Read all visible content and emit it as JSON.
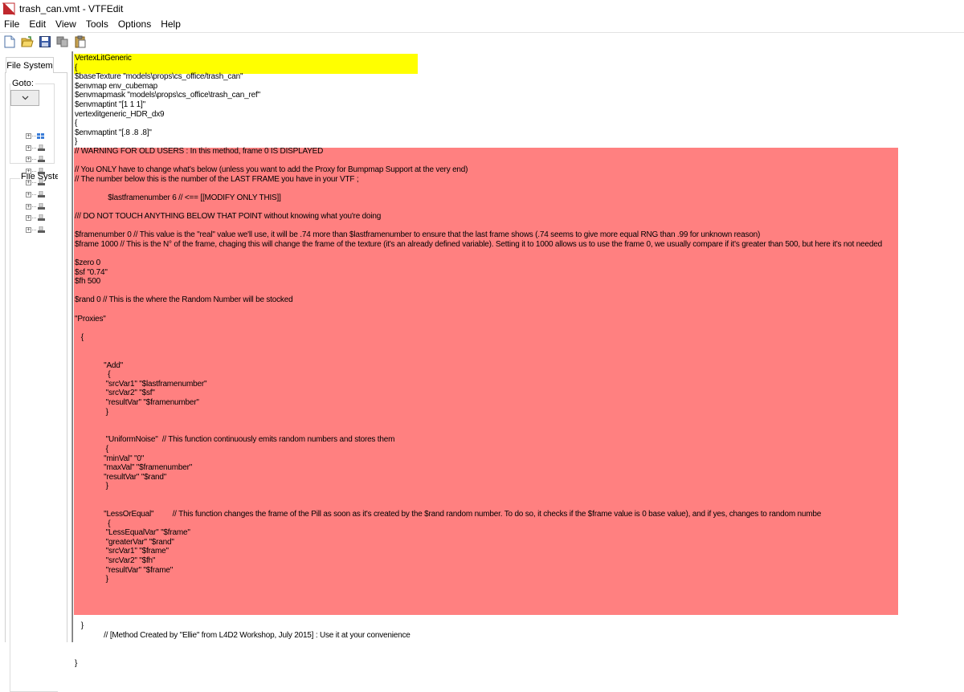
{
  "window": {
    "title": "trash_can.vmt - VTFEdit"
  },
  "menu": {
    "items": [
      "File",
      "Edit",
      "View",
      "Tools",
      "Options",
      "Help"
    ]
  },
  "toolbar": {
    "buttons": [
      "new-icon",
      "open-icon",
      "save-icon",
      "copy-icon",
      "paste-icon"
    ]
  },
  "left_panel": {
    "tab_label": "File System",
    "goto_label": "Goto:",
    "fs_label": "File System",
    "tree_item_count": 9
  },
  "editor": {
    "lines": [
      "VertexLitGeneric",
      "{",
      "$baseTexture \"models\\props\\cs_office/trash_can\"",
      "$envmap env_cubemap",
      "$envmapmask \"models\\props\\cs_office\\trash_can_ref\"",
      "$envmaptint \"[1 1 1]\"",
      "vertexlitgeneric_HDR_dx9",
      "{",
      "$envmaptint \"[.8 .8 .8]\"",
      "}",
      "// WARNING FOR OLD USERS : In this method, frame 0 IS DISPLAYED",
      "",
      "// You ONLY have to change what's below (unless you want to add the Proxy for Bumpmap Support at the very end)",
      "// The number below this is the number of the LAST FRAME you have in your VTF ;",
      "",
      "                $lastframenumber 6 // <== [[MODIFY ONLY THIS]]",
      "",
      "/// DO NOT TOUCH ANYTHING BELOW THAT POINT without knowing what you're doing",
      "",
      "$framenumber 0 // This value is the \"real\" value we'll use, it will be .74 more than $lastframenumber to ensure that the last frame shows (.74 seems to give more equal RNG than .99 for unknown reason)",
      "$frame 1000 // This is the N° of the frame, chaging this will change the frame of the texture (it's an already defined variable). Setting it to 1000 allows us to use the frame 0, we usually compare if it's greater than 500, but here it's not needed",
      "",
      "$zero 0",
      "$sf \"0.74\"",
      "$fh 500",
      "",
      "$rand 0 // This is the where the Random Number will be stocked",
      "",
      "\"Proxies\"",
      "",
      "   {",
      "",
      "",
      "              \"Add\"",
      "                {",
      "               \"srcVar1\" \"$lastframenumber\"",
      "               \"srcVar2\" \"$sf\"",
      "               \"resultVar\" \"$framenumber\"",
      "               }",
      "",
      "",
      "               \"UniformNoise\"  // This function continuously emits random numbers and stores them",
      "               {",
      "              \"minVal\" \"0\"",
      "              \"maxVal\" \"$framenumber\"",
      "              \"resultVar\" \"$rand\"",
      "               }",
      "",
      "",
      "              \"LessOrEqual\"         // This function changes the frame of the Pill as soon as it's created by the $rand random number. To do so, it checks if the $frame value is 0 base value), and if yes, changes to random numbe",
      "                {",
      "               \"LessEqualVar\" \"$frame\"",
      "               \"greaterVar\" \"$rand\"",
      "               \"srcVar1\" \"$frame\"",
      "               \"srcVar2\" \"$fh\"",
      "               \"resultVar\" \"$frame\"",
      "               }",
      "",
      "",
      "",
      "",
      "   }",
      "              // [Method Created by \"Ellie\" from L4D2 Workshop, July 2015] : Use it at your convenience",
      "",
      "",
      "}"
    ]
  },
  "colors": {
    "highlight_yellow": "#ffff00",
    "highlight_red": "#ff8080"
  }
}
